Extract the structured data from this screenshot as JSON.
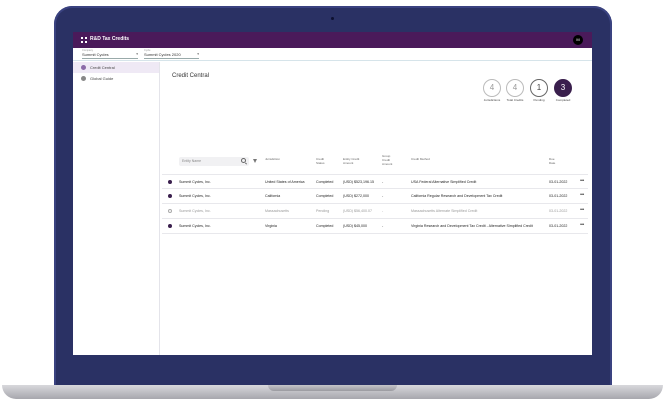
{
  "app": {
    "title": "R&D Tax Credits",
    "user_initial": "M"
  },
  "filters": [
    {
      "caption": "Company",
      "value": "Summit Cycles"
    },
    {
      "caption": "Cycle",
      "value": "Summit Cycles 2020"
    }
  ],
  "sidebar": {
    "items": [
      {
        "label": "Credit Central",
        "active": true
      },
      {
        "label": "Global Guide",
        "active": false
      }
    ]
  },
  "main": {
    "title": "Credit Central"
  },
  "stats": [
    {
      "value": "4",
      "label": "Jurisdictions"
    },
    {
      "value": "4",
      "label": "Total Credits"
    },
    {
      "value": "1",
      "label": "Pending"
    },
    {
      "value": "3",
      "label": "Completed"
    }
  ],
  "search": {
    "placeholder": "Entity Name"
  },
  "table": {
    "columns": [
      "Jurisdiction",
      "Credit Status",
      "Entity Credit Amount",
      "Group Credit Amount",
      "Credit Method",
      "Due Date"
    ],
    "rows": [
      {
        "entity": "Summit Cycles, Inc.",
        "jurisdiction": "United States of America",
        "status": "Completed",
        "entity_amount": "(USD) $523,196.15",
        "group_amount": "-",
        "method": "USA Federal Alternative Simplified Credit",
        "due": "03-01-2022"
      },
      {
        "entity": "Summit Cycles, Inc.",
        "jurisdiction": "California",
        "status": "Completed",
        "entity_amount": "(USD) $272,000",
        "group_amount": "-",
        "method": "California Regular Research and Development Tax Credit",
        "due": "03-01-2022"
      },
      {
        "entity": "Summit Cycles, Inc.",
        "jurisdiction": "Massachusetts",
        "status": "Pending",
        "entity_amount": "(USD) $56,400.07",
        "group_amount": "-",
        "method": "Massachusetts Alternate Simplified Credit",
        "due": "03-01-2022"
      },
      {
        "entity": "Summit Cycles, Inc.",
        "jurisdiction": "Virginia",
        "status": "Completed",
        "entity_amount": "(USD) $45,000",
        "group_amount": "-",
        "method": "Virginia Research and Development Tax Credit - Alternative Simplified Credit",
        "due": "03-01-2022"
      }
    ]
  },
  "colors": {
    "brand": "#4a1a5a",
    "accent": "#3a1f4d",
    "bezel": "#2a3164"
  },
  "icons": [
    "grid-icon",
    "search-icon",
    "filter-icon",
    "more-icon",
    "nav-icon"
  ]
}
